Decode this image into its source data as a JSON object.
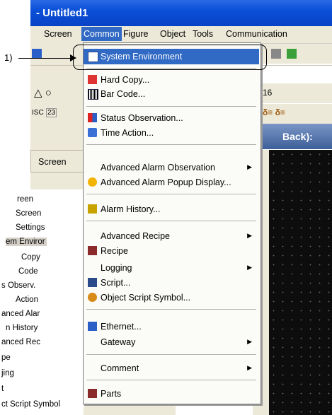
{
  "window": {
    "title": "- Untitled1"
  },
  "menubar": {
    "items": [
      "Screen",
      "Common",
      "Figure",
      "Object",
      "Tools",
      "Communication"
    ],
    "active": "Common"
  },
  "callout": {
    "label": "1)"
  },
  "toolbar": {
    "zoom_value": "16"
  },
  "panel": {
    "title": "Back):"
  },
  "screen_tab": {
    "label": "Screen"
  },
  "tree": {
    "items": [
      "reen",
      "Screen",
      "Settings",
      "em Enviror",
      "Copy",
      "Code",
      "s Observ.",
      "Action",
      "anced Alar",
      "n History",
      "anced Rec",
      "pe",
      "jing",
      "t",
      "ct Script Symbol"
    ]
  },
  "dropdown": {
    "items": [
      {
        "label": "System Environment",
        "icon": "system-environment-icon",
        "highlighted": true
      },
      {
        "label": "Hard Copy...",
        "icon": "hard-copy-icon"
      },
      {
        "label": "Bar Code...",
        "icon": "bar-code-icon"
      },
      {
        "label": "Status Observation...",
        "icon": "status-observation-icon"
      },
      {
        "label": "Time Action...",
        "icon": "time-action-icon"
      },
      {
        "label": "Advanced Alarm Observation",
        "submenu": true
      },
      {
        "label": "Advanced Alarm Popup Display...",
        "icon": "alarm-popup-icon"
      },
      {
        "label": "Alarm History...",
        "icon": "alarm-history-icon"
      },
      {
        "label": "Advanced Recipe",
        "submenu": true
      },
      {
        "label": "Recipe",
        "icon": "recipe-icon"
      },
      {
        "label": "Logging",
        "submenu": true
      },
      {
        "label": "Script...",
        "icon": "script-icon"
      },
      {
        "label": "Object Script Symbol...",
        "icon": "object-script-icon"
      },
      {
        "label": "Ethernet...",
        "icon": "ethernet-icon"
      },
      {
        "label": "Gateway",
        "submenu": true
      },
      {
        "label": "Comment",
        "submenu": true
      },
      {
        "label": "Parts",
        "icon": "parts-icon"
      }
    ]
  },
  "colors": {
    "highlight": "#316ac5",
    "titlebar": "#0a4fd8",
    "canvas": "#0d0d0d"
  }
}
